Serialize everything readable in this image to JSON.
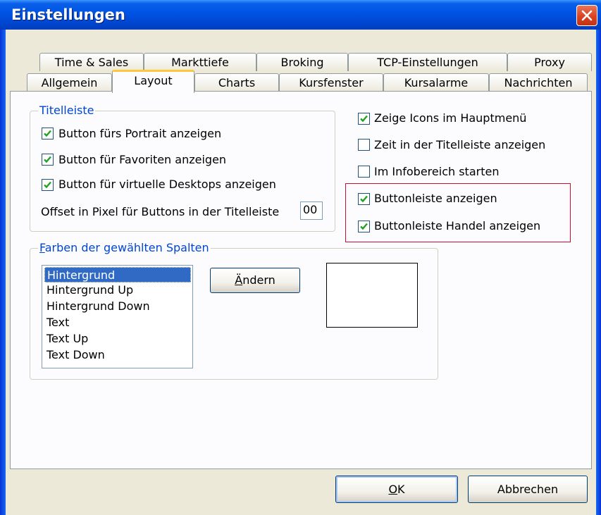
{
  "window": {
    "title": "Einstellungen"
  },
  "tabs_row_back": [
    {
      "label": "Time & Sales"
    },
    {
      "label": "Markttiefe"
    },
    {
      "label": "Broking"
    },
    {
      "label": "TCP-Einstellungen"
    },
    {
      "label": "Proxy"
    }
  ],
  "tabs_row_front": [
    {
      "label": "Allgemein"
    },
    {
      "label": "Layout"
    },
    {
      "label": "Charts"
    },
    {
      "label": "Kursfenster"
    },
    {
      "label": "Kursalarme"
    },
    {
      "label": "Nachrichten"
    }
  ],
  "active_tab": "Layout",
  "titelleiste": {
    "label": "Titelleiste",
    "options": [
      {
        "label": "Button fürs Portrait anzeigen",
        "checked": true
      },
      {
        "label": "Button für Favoriten anzeigen",
        "checked": true
      },
      {
        "label": "Button für virtuelle Desktops anzeigen",
        "checked": true
      }
    ],
    "offset_label": "Offset in Pixel für Buttons in der Titelleiste",
    "offset_value": "00"
  },
  "right_options": [
    {
      "label": "Zeige Icons im Hauptmenü",
      "checked": true
    },
    {
      "label": "Zeit in der Titelleiste anzeigen",
      "checked": false
    },
    {
      "label": "Im Infobereich starten",
      "checked": false
    },
    {
      "label": "Buttonleiste anzeigen",
      "checked": true
    },
    {
      "label": "Buttonleiste Handel anzeigen",
      "checked": true
    }
  ],
  "farben": {
    "label_first": "F",
    "label_rest": "arben der gewählten Spalten",
    "items": [
      {
        "label": "Hintergrund",
        "selected": true
      },
      {
        "label": "Hintergrund Up",
        "selected": false
      },
      {
        "label": "Hintergrund Down",
        "selected": false
      },
      {
        "label": "Text",
        "selected": false
      },
      {
        "label": "Text Up",
        "selected": false
      },
      {
        "label": "Text Down",
        "selected": false
      }
    ],
    "change_button_first": "Ä",
    "change_button_rest": "ndern",
    "preview_color": "#ffffff"
  },
  "footer": {
    "ok_first": "O",
    "ok_rest": "K",
    "cancel": "Abbrechen"
  },
  "colors": {
    "titlebar": "#0055e5",
    "dialog_bg": "#ece9d8",
    "selection": "#316ac5",
    "group_label": "#0046d5",
    "highlight_box": "#c8102e",
    "checkmark": "#21a121"
  }
}
